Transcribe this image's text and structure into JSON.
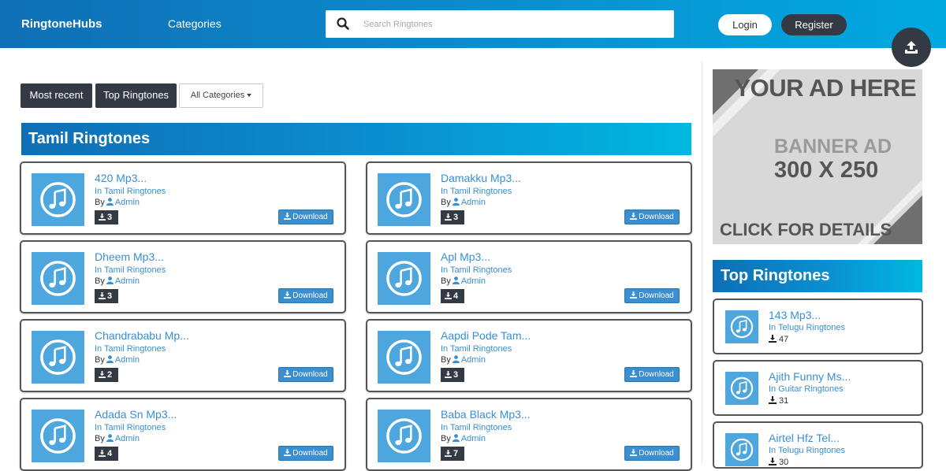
{
  "header": {
    "logo": "RingtoneHubs",
    "nav_categories": "Categories",
    "search_placeholder": "Search Ringtones",
    "login": "Login",
    "register": "Register",
    "upload_icon": "upload-icon"
  },
  "filters": {
    "most_recent": "Most recent",
    "top_ringtones": "Top Ringtones",
    "all_categories": "All Categories"
  },
  "main": {
    "section_title": "Tamil Ringtones",
    "by_label": "By",
    "download_label": "Download",
    "cards": [
      {
        "title": "420 Mp3...",
        "category": "In Tamil Ringtones",
        "author": "Admin",
        "downloads": "3"
      },
      {
        "title": "Damakku Mp3...",
        "category": "In Tamil Ringtones",
        "author": "Admin",
        "downloads": "3"
      },
      {
        "title": "Dheem Mp3...",
        "category": "In Tamil Ringtones",
        "author": "Admin",
        "downloads": "3"
      },
      {
        "title": "Apl Mp3...",
        "category": "In Tamil Ringtones",
        "author": "Admin",
        "downloads": "4"
      },
      {
        "title": "Chandrababu Mp...",
        "category": "In Tamil Ringtones",
        "author": "Admin",
        "downloads": "2"
      },
      {
        "title": "Aapdi Pode Tam...",
        "category": "In Tamil Ringtones",
        "author": "Admin",
        "downloads": "3"
      },
      {
        "title": "Adada Sn Mp3...",
        "category": "In Tamil Ringtones",
        "author": "Admin",
        "downloads": "4"
      },
      {
        "title": "Baba Black Mp3...",
        "category": "In Tamil Ringtones",
        "author": "Admin",
        "downloads": "7"
      }
    ]
  },
  "sidebar": {
    "ad": {
      "line1": "YOUR AD HERE",
      "line2": "BANNER AD",
      "line3": "300 X 250",
      "line4": "CLICK FOR DETAILS"
    },
    "section_title": "Top Ringtones",
    "items": [
      {
        "title": "143 Mp3...",
        "category": "In Telugu Ringtones",
        "downloads": "47"
      },
      {
        "title": "Ajith Funny Ms...",
        "category": "In Guitar Ringtones",
        "downloads": "31"
      },
      {
        "title": "Airtel Hfz Tel...",
        "category": "In Telugu Ringtones",
        "downloads": "30"
      }
    ]
  },
  "colors": {
    "header_gradient_start": "#0f6fb6",
    "header_gradient_end": "#00a9e0",
    "dark_button": "#333a44",
    "accent_blue": "#3a8fd0",
    "thumb_blue": "#4ea6de"
  }
}
